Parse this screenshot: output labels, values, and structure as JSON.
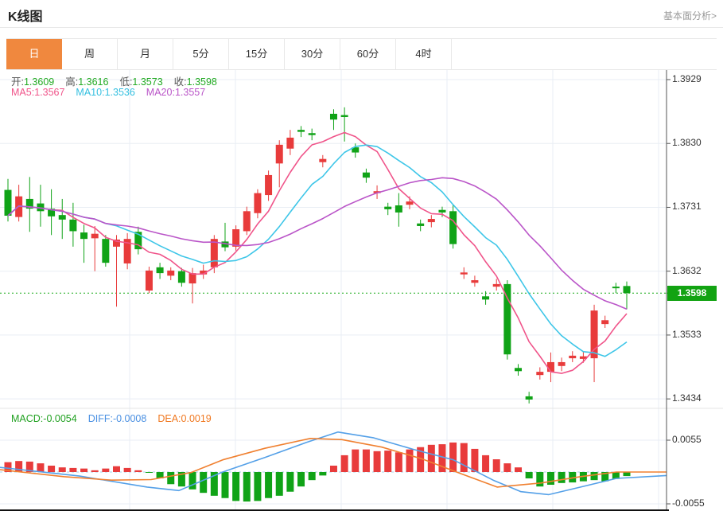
{
  "header": {
    "title": "K线图",
    "link_label": "基本面分析>"
  },
  "tabs": {
    "selected_index": 0,
    "items": [
      "日",
      "周",
      "月",
      "5分",
      "15分",
      "30分",
      "60分",
      "4时"
    ]
  },
  "legend": {
    "ohlc": [
      {
        "label": "开:",
        "value": "1.3609"
      },
      {
        "label": "高:",
        "value": "1.3616"
      },
      {
        "label": "低:",
        "value": "1.3573"
      },
      {
        "label": "收:",
        "value": "1.3598"
      }
    ],
    "ohlc_value_color": "#21aa21",
    "ma": [
      {
        "label": "MA5:",
        "value": "1.3567",
        "color": "#f0548a"
      },
      {
        "label": "MA10:",
        "value": "1.3536",
        "color": "#35c0e0"
      },
      {
        "label": "MA20:",
        "value": "1.3557",
        "color": "#ba55c8"
      }
    ],
    "macd": [
      {
        "label": "MACD:",
        "value": "-0.0054",
        "color": "#21a121"
      },
      {
        "label": "DIFF:",
        "value": "-0.0008",
        "color": "#4a90e2"
      },
      {
        "label": "DEA:",
        "value": "0.0019",
        "color": "#f07820"
      }
    ]
  },
  "price_badge": "1.3598",
  "colors": {
    "up": "#e83b3b",
    "down": "#10a317",
    "ma5": "#f0548a",
    "ma10": "#3ec6e8",
    "ma20": "#ba55c8",
    "diff_line": "#54a0e8",
    "dea_line": "#f08030",
    "grid": "#e9eef4",
    "axis": "#555555",
    "dotted_price_line": "#16a916",
    "zero_dash": "#a6d2ea",
    "tab_selected_bg": "#f0883e",
    "badge_bg": "#12a312"
  },
  "chart_data": {
    "type": "candlestick",
    "title": "K线图",
    "main_panel": {
      "y_axis_labels": [
        "1.3929",
        "1.3830",
        "1.3731",
        "1.3632",
        "1.3533",
        "1.3434"
      ],
      "last_price": 1.3598,
      "ma_periods": [
        5,
        10,
        20
      ],
      "candles_ohlc": [
        [
          1.3758,
          1.3775,
          1.3709,
          1.3718
        ],
        [
          1.3716,
          1.3766,
          1.3709,
          1.3748
        ],
        [
          1.3744,
          1.3778,
          1.3693,
          1.3729
        ],
        [
          1.3737,
          1.3766,
          1.3701,
          1.3725
        ],
        [
          1.3729,
          1.3759,
          1.3688,
          1.3717
        ],
        [
          1.3719,
          1.3744,
          1.3682,
          1.3712
        ],
        [
          1.3712,
          1.3738,
          1.367,
          1.3694
        ],
        [
          1.3692,
          1.3704,
          1.3645,
          1.3682
        ],
        [
          1.3683,
          1.3702,
          1.3632,
          1.369
        ],
        [
          1.3682,
          1.3688,
          1.3639,
          1.3645
        ],
        [
          1.367,
          1.3688,
          1.3577,
          1.3681
        ],
        [
          1.3644,
          1.3691,
          1.3635,
          1.3682
        ],
        [
          1.3693,
          1.3701,
          1.3658,
          1.3666
        ],
        [
          1.3602,
          1.3639,
          1.3598,
          1.3633
        ],
        [
          1.3638,
          1.3645,
          1.362,
          1.3629
        ],
        [
          1.3625,
          1.3638,
          1.3618,
          1.3633
        ],
        [
          1.3632,
          1.3637,
          1.3608,
          1.3614
        ],
        [
          1.3613,
          1.3637,
          1.3582,
          1.3629
        ],
        [
          1.3627,
          1.3642,
          1.362,
          1.3633
        ],
        [
          1.3638,
          1.3688,
          1.3629,
          1.3682
        ],
        [
          1.3678,
          1.3707,
          1.3663,
          1.3669
        ],
        [
          1.367,
          1.3703,
          1.3664,
          1.3697
        ],
        [
          1.3694,
          1.3732,
          1.3688,
          1.3725
        ],
        [
          1.3722,
          1.3759,
          1.3714,
          1.3753
        ],
        [
          1.375,
          1.3788,
          1.3741,
          1.3781
        ],
        [
          1.3799,
          1.3835,
          1.3762,
          1.3828
        ],
        [
          1.3822,
          1.3851,
          1.3812,
          1.3839
        ],
        [
          1.3851,
          1.3857,
          1.384,
          1.3848
        ],
        [
          1.3846,
          1.3853,
          1.3835,
          1.3843
        ],
        [
          1.3801,
          1.3812,
          1.3793,
          1.3806
        ],
        [
          1.3876,
          1.3883,
          1.3851,
          1.3867
        ],
        [
          1.3874,
          1.3886,
          1.3833,
          1.3871
        ],
        [
          1.3824,
          1.383,
          1.3808,
          1.3816
        ],
        [
          1.3785,
          1.3791,
          1.3769,
          1.3777
        ],
        [
          1.3753,
          1.3765,
          1.3744,
          1.3756
        ],
        [
          1.3732,
          1.3738,
          1.3719,
          1.3728
        ],
        [
          1.3734,
          1.3753,
          1.3701,
          1.3723
        ],
        [
          1.3735,
          1.3748,
          1.3728,
          1.374
        ],
        [
          1.3706,
          1.3712,
          1.3694,
          1.3702
        ],
        [
          1.3708,
          1.3719,
          1.37,
          1.3713
        ],
        [
          1.3727,
          1.3732,
          1.3716,
          1.3723
        ],
        [
          1.3725,
          1.3735,
          1.3667,
          1.3674
        ],
        [
          1.3627,
          1.3638,
          1.362,
          1.363
        ],
        [
          1.3614,
          1.3625,
          1.3608,
          1.3618
        ],
        [
          1.3593,
          1.3601,
          1.358,
          1.3588
        ],
        [
          1.3608,
          1.362,
          1.3602,
          1.3612
        ],
        [
          1.3612,
          1.3618,
          1.3495,
          1.3503
        ],
        [
          1.3482,
          1.3488,
          1.347,
          1.3477
        ],
        [
          1.3438,
          1.3445,
          1.3427,
          1.3433
        ],
        [
          1.3471,
          1.3483,
          1.3464,
          1.3476
        ],
        [
          1.3476,
          1.3506,
          1.346,
          1.3491
        ],
        [
          1.3485,
          1.3498,
          1.3477,
          1.3491
        ],
        [
          1.3497,
          1.3508,
          1.3491,
          1.3501
        ],
        [
          1.3496,
          1.3507,
          1.349,
          1.35
        ],
        [
          1.3497,
          1.358,
          1.346,
          1.3571
        ],
        [
          1.355,
          1.3563,
          1.3544,
          1.3556
        ],
        [
          1.3608,
          1.3614,
          1.3598,
          1.3606
        ],
        [
          1.3609,
          1.3616,
          1.3573,
          1.3598
        ]
      ]
    },
    "macd_panel": {
      "y_axis_labels": [
        "0.0055",
        "-0.0055"
      ],
      "macd_value": -0.0054,
      "diff_value": -0.0008,
      "dea_value": 0.0019,
      "histogram": [
        0.0017,
        0.0019,
        0.0018,
        0.0015,
        0.0011,
        0.0008,
        0.0007,
        0.0006,
        0.0003,
        0.0006,
        0.001,
        0.0007,
        0.0003,
        -0.0001,
        -0.0011,
        -0.0021,
        -0.0025,
        -0.003,
        -0.0036,
        -0.0041,
        -0.0045,
        -0.005,
        -0.0051,
        -0.005,
        -0.0045,
        -0.0041,
        -0.0034,
        -0.0025,
        -0.0014,
        -0.0006,
        0.0011,
        0.0029,
        0.0039,
        0.0039,
        0.0036,
        0.0037,
        0.0034,
        0.0039,
        0.0043,
        0.0047,
        0.0048,
        0.0051,
        0.005,
        0.004,
        0.0029,
        0.0022,
        0.0015,
        0.0008,
        -0.0011,
        -0.0025,
        -0.0022,
        -0.0019,
        -0.0018,
        -0.0016,
        -0.0014,
        -0.0016,
        -0.0012,
        -0.0007
      ],
      "diff_line_points": [
        [
          0,
          0.0008
        ],
        [
          100,
          -0.0007
        ],
        [
          185,
          -0.0026
        ],
        [
          225,
          -0.0032
        ],
        [
          280,
          0.0
        ],
        [
          333,
          0.0025
        ],
        [
          385,
          0.0051
        ],
        [
          425,
          0.0069
        ],
        [
          470,
          0.0059
        ],
        [
          520,
          0.0039
        ],
        [
          570,
          0.0021
        ],
        [
          620,
          -0.0014
        ],
        [
          655,
          -0.0034
        ],
        [
          690,
          -0.0039
        ],
        [
          730,
          -0.0026
        ],
        [
          775,
          -0.0011
        ],
        [
          838,
          -0.0006
        ]
      ],
      "dea_line_points": [
        [
          0,
          0.0004
        ],
        [
          80,
          -0.0008
        ],
        [
          140,
          -0.0014
        ],
        [
          190,
          -0.0013
        ],
        [
          240,
          -0.0001
        ],
        [
          280,
          0.0021
        ],
        [
          333,
          0.0041
        ],
        [
          390,
          0.0058
        ],
        [
          430,
          0.0056
        ],
        [
          480,
          0.0043
        ],
        [
          530,
          0.0023
        ],
        [
          580,
          -0.0003
        ],
        [
          625,
          -0.0026
        ],
        [
          680,
          -0.0019
        ],
        [
          730,
          -0.0008
        ],
        [
          775,
          0.0
        ],
        [
          838,
          0.0
        ]
      ]
    }
  }
}
